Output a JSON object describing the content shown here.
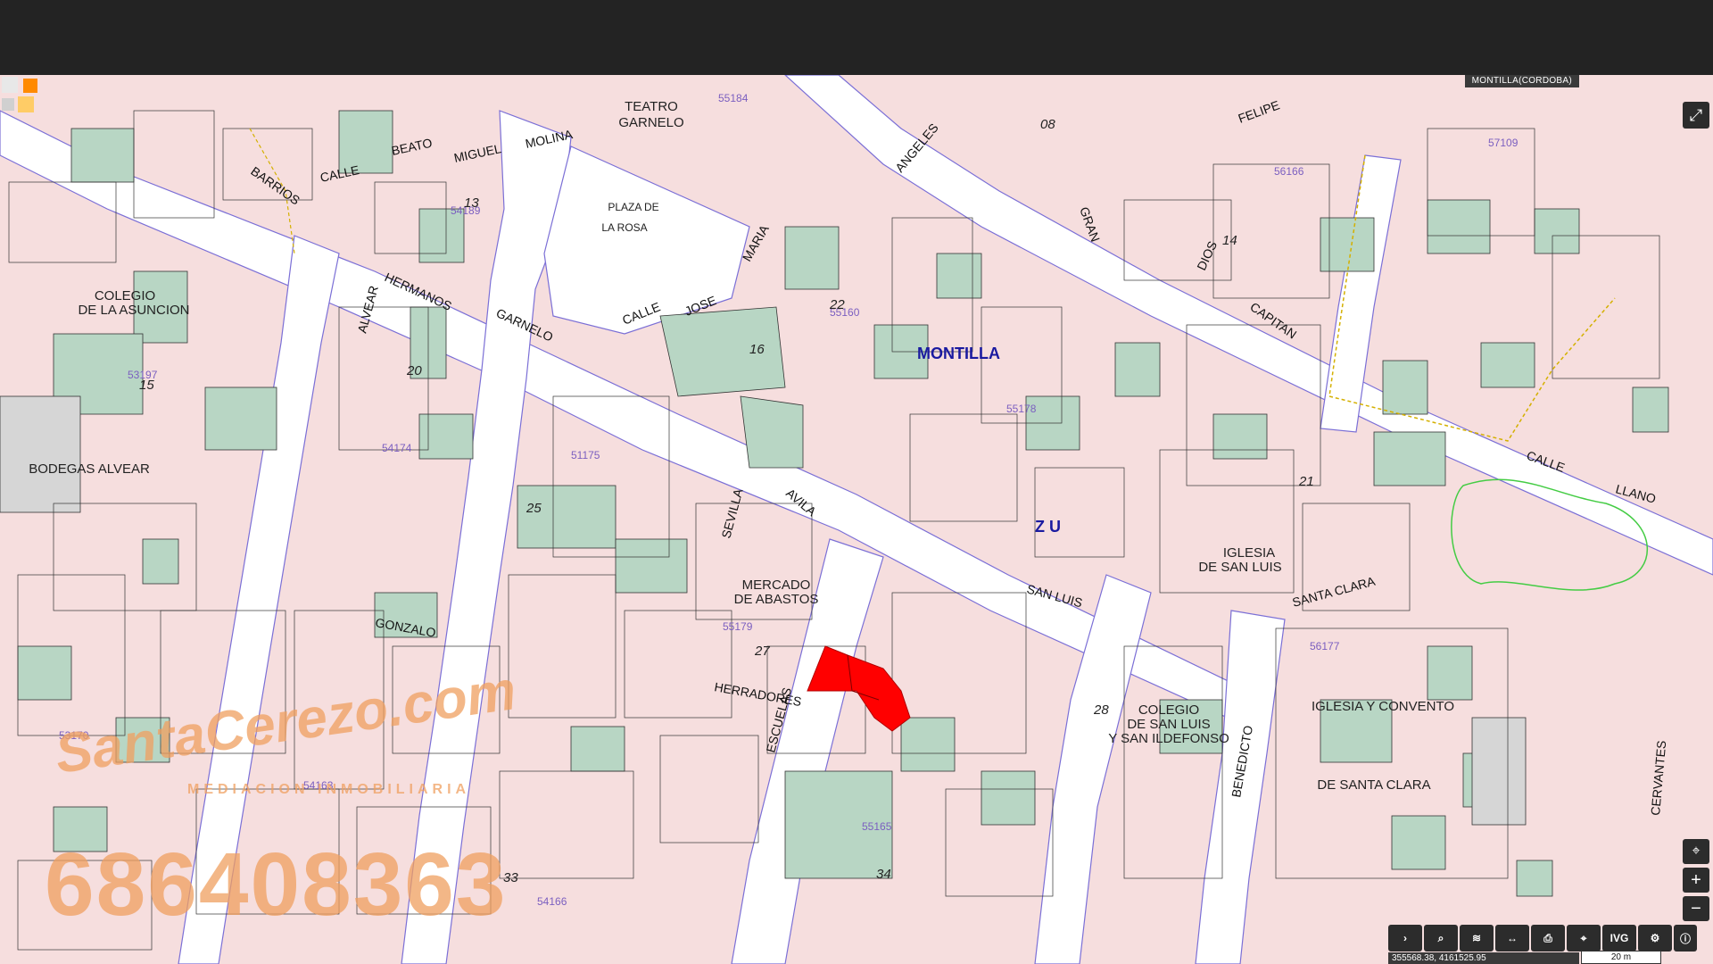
{
  "map": {
    "place": "MONTILLA(CORDOBA)",
    "town_label": "MONTILLA",
    "zone_label": "Z U",
    "landmarks": {
      "teatro": [
        "TEATRO",
        "GARNELO"
      ],
      "plaza": [
        "PLAZA DE",
        "LA ROSA"
      ],
      "colegio_asuncion": [
        "COLEGIO",
        "DE LA ASUNCION"
      ],
      "bodegas": "BODEGAS ALVEAR",
      "mercado": [
        "MERCADO",
        "DE ABASTOS"
      ],
      "iglesia_luis": [
        "IGLESIA",
        "DE SAN LUIS"
      ],
      "colegio_luis": [
        "COLEGIO",
        "DE SAN LUIS",
        "Y SAN ILDEFONSO"
      ],
      "convento": [
        "IGLESIA Y CONVENTO",
        "DE SANTA CLARA"
      ]
    },
    "streets": {
      "molina": "MOLINA",
      "barrios": "BARRIOS",
      "beato": "BEATO",
      "miguel": "MIGUEL",
      "jose": "JOSE",
      "maria": "MARIA",
      "angeles": "ANGELES",
      "gran": "GRAN",
      "capitan": "CAPITAN",
      "dios": "DIOS",
      "felipe": "FELIPE",
      "herradores": "HERRADORES",
      "gonzalo": "GONZALO",
      "sevilla": "SEVILLA",
      "escuelas": "ESCUELAS",
      "san_luis": "SAN LUIS",
      "santa_clara": "SANTA CLARA",
      "llano": "LLANO",
      "cervantes": "CERVANTES",
      "benedicto": "BENEDICTO",
      "avila": "AVILA",
      "alvear": "ALVEAR",
      "garnelo": "GARNELO",
      "hermanos": "HERMANOS",
      "calle": "CALLE"
    },
    "block_codes": [
      "55184",
      "55160",
      "54189",
      "53197",
      "54174",
      "51175",
      "55179",
      "56177",
      "54163",
      "53170",
      "55165",
      "54166",
      "57109",
      "56166",
      "55178"
    ],
    "block_numbers": [
      "13",
      "16",
      "22",
      "20",
      "25",
      "15",
      "27",
      "21",
      "28",
      "33",
      "34",
      "14",
      "08"
    ],
    "coordinates": "355568.38, 4161525.95",
    "scale": "20 m",
    "watermark": {
      "brand": "SantaCerezo.com",
      "sub": "MEDIACION INMOBILIARIA",
      "phone": "686408363"
    },
    "highlight_color": "#ff0000",
    "parcel_color": "#f6dede",
    "green_color": "#b8d6c4",
    "line_color": "#6a5acd"
  },
  "toolbar": {
    "icons": [
      "chevron-right-icon",
      "search-icon",
      "layers-icon",
      "measure-icon",
      "print-icon",
      "location-icon",
      "ivg-icon",
      "share-icon"
    ],
    "ivg_label": "IVG",
    "info_icon": "info-icon"
  }
}
